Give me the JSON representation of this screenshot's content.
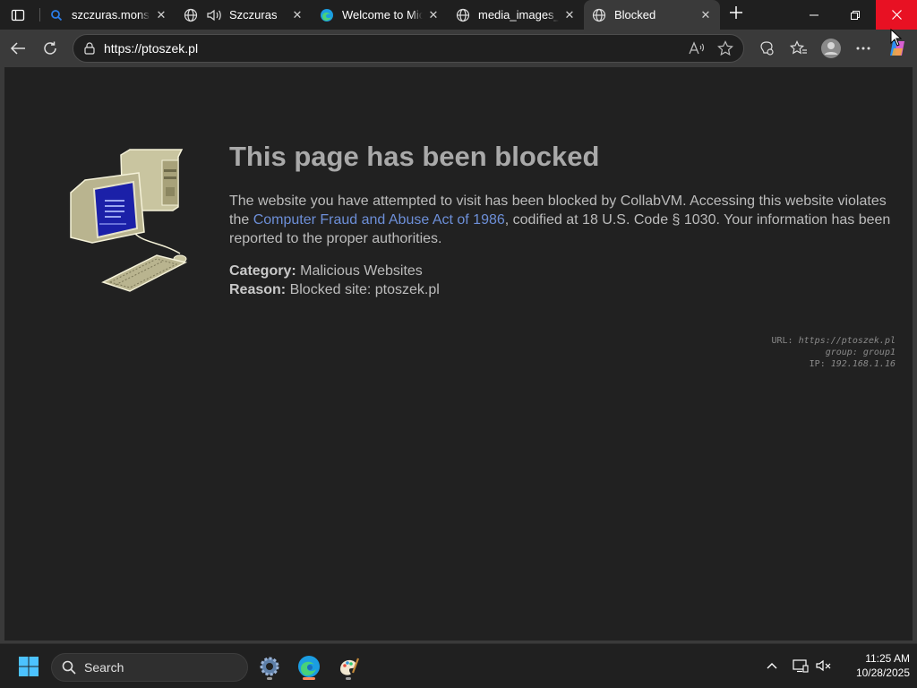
{
  "browser": {
    "tabs": [
      {
        "label": "szczuras.mons - Szukaj",
        "icon": "search-favicon",
        "active": false
      },
      {
        "label": "Szczuras",
        "icon": "globe-favicon",
        "active": false,
        "audio": true
      },
      {
        "label": "Welcome to Microsoft Edge",
        "icon": "edge-favicon",
        "active": false
      },
      {
        "label": "media_images_ran",
        "icon": "globe-favicon",
        "active": false
      },
      {
        "label": "Blocked",
        "icon": "globe-favicon",
        "active": true
      }
    ],
    "address": {
      "url": "https://ptoszek.pl"
    }
  },
  "page": {
    "title": "This page has been blocked",
    "description_before": "The website you have attempted to visit has been blocked by CollabVM. Accessing this website violates the ",
    "link_text": "Computer Fraud and Abuse Act of 1986",
    "description_after": ", codified at 18 U.S. Code § 1030. Your information has been reported to the proper authorities.",
    "category_label": "Category:",
    "category_value": "Malicious Websites",
    "reason_label": "Reason:",
    "reason_value": "Blocked site: ptoszek.pl",
    "diagnostics": {
      "url_label": "URL:",
      "url_value": "https://ptoszek.pl",
      "group_label": "group:",
      "group_value": "group1",
      "ip_label": "IP:",
      "ip_value": "192.168.1.16"
    }
  },
  "taskbar": {
    "search_placeholder": "Search",
    "time": "11:25 AM",
    "date": "10/28/2025"
  },
  "colors": {
    "close_button": "#e81123",
    "link": "#6d8fd8",
    "edge_indicator": "#ff8a5c"
  }
}
